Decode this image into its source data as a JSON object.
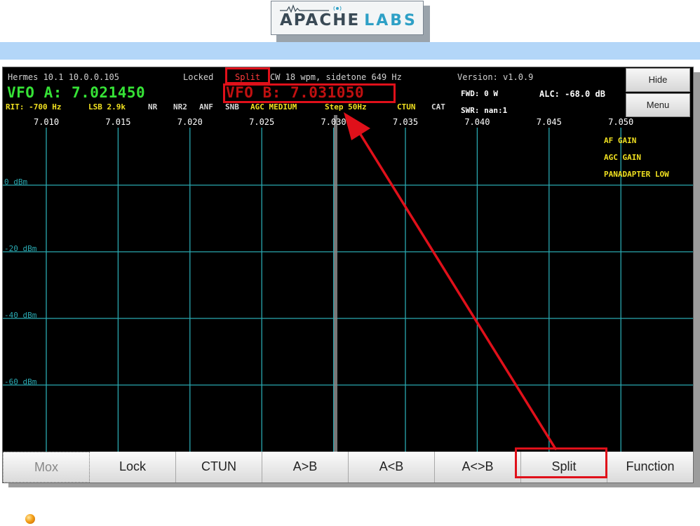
{
  "logo": {
    "word1": "APACHE",
    "word2": "LABS"
  },
  "radio": {
    "status_text": "Hermes 10.1 10.0.0.105",
    "locked": "Locked",
    "split_flag": "Split",
    "cw_info": "CW 18 wpm, sidetone 649 Hz",
    "version": "Version: v1.0.9",
    "vfo_a": "VFO A: 7.021450",
    "vfo_b": "VFO B: 7.031050",
    "fwd": "FWD: 0 W",
    "alc": "ALC: -68.0 dB",
    "swr": "SWR: nan:1",
    "status_line": [
      {
        "text": "RIT: -700 Hz",
        "color": "#f0e020"
      },
      {
        "text": "LSB 2.9k",
        "color": "#f0e020"
      },
      {
        "text": "NR",
        "color": "#d8d8d8"
      },
      {
        "text": "NR2",
        "color": "#d8d8d8"
      },
      {
        "text": "ANF",
        "color": "#d8d8d8"
      },
      {
        "text": "SNB",
        "color": "#d8d8d8"
      },
      {
        "text": "AGC MEDIUM",
        "color": "#f0e020"
      },
      {
        "text": "Step 50Hz",
        "color": "#f0e020"
      },
      {
        "text": "CTUN",
        "color": "#f0e020"
      },
      {
        "text": "CAT",
        "color": "#d8d8d8"
      }
    ],
    "side_buttons": {
      "hide": "Hide",
      "menu": "Menu"
    },
    "panadapter": {
      "freq_ticks": [
        "7.010",
        "7.015",
        "7.020",
        "7.025",
        "7.030",
        "7.035",
        "7.040",
        "7.045",
        "7.050"
      ],
      "dbm_labels": [
        "0 dBm",
        "-20 dBm",
        "-40 dBm",
        "-60 dBm"
      ],
      "overlay_labels": [
        "AF GAIN",
        "AGC GAIN",
        "PANADAPTER LOW"
      ],
      "grid_color": "#2aa8b0"
    },
    "bottom_buttons": [
      "Mox",
      "Lock",
      "CTUN",
      "A>B",
      "A<B",
      "A<>B",
      "Split",
      "Function"
    ]
  },
  "annotation_color": "#e0101a"
}
